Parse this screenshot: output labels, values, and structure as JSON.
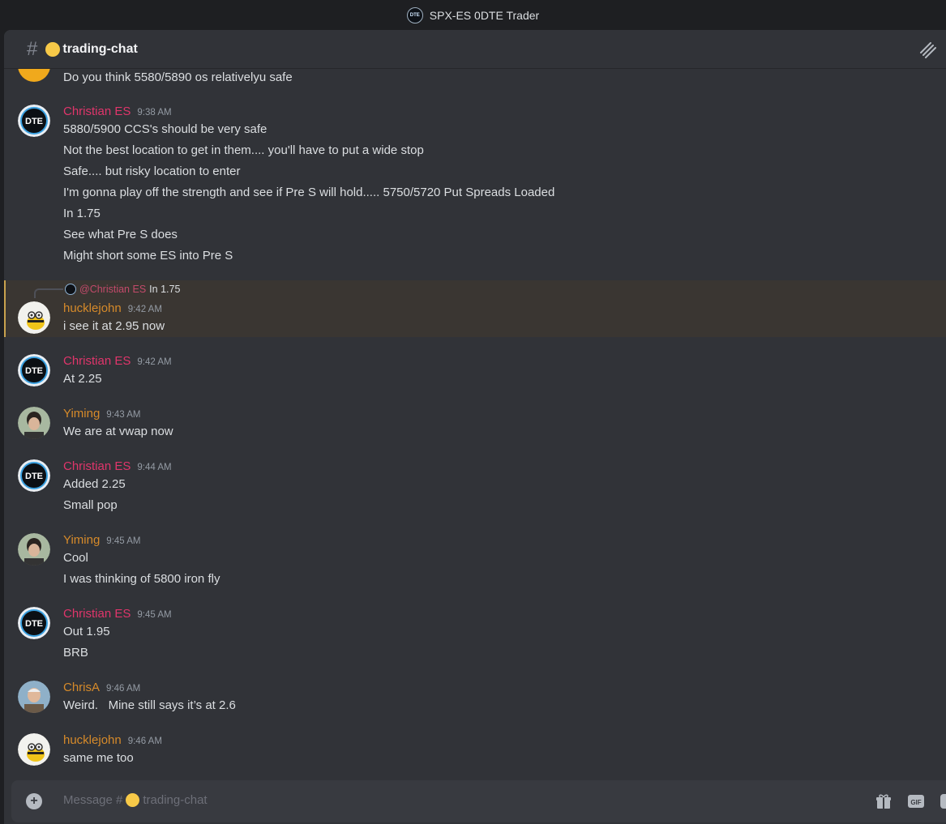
{
  "window": {
    "title": "SPX-ES 0DTE Trader",
    "logo_text": "DTE"
  },
  "channel": {
    "hash": "#",
    "name": "trading-chat"
  },
  "colors": {
    "christian": "#e0356b",
    "other": "#d68a2a"
  },
  "messages": [
    {
      "author": "",
      "time": "",
      "lines": [
        "Do you think 5580/5890 os relativelyu safe"
      ]
    },
    {
      "author": "Christian ES",
      "time": "9:38 AM",
      "lines": [
        "5880/5900 CCS's should be very safe",
        "Not the best location to get in them.... you'll have to put a wide stop",
        "Safe.... but risky location to enter",
        "I'm gonna play off the strength and see if Pre S will hold..... 5750/5720 Put Spreads Loaded",
        "In 1.75",
        "See what Pre S does",
        "Might short some ES into Pre S"
      ]
    },
    {
      "author": "hucklejohn",
      "time": "9:42 AM",
      "reply": {
        "mention": "@Christian ES",
        "text": "In 1.75"
      },
      "lines": [
        "i see it at 2.95 now"
      ]
    },
    {
      "author": "Christian ES",
      "time": "9:42 AM",
      "lines": [
        "At 2.25"
      ]
    },
    {
      "author": "Yiming",
      "time": "9:43 AM",
      "lines": [
        "We are at vwap now"
      ]
    },
    {
      "author": "Christian ES",
      "time": "9:44 AM",
      "lines": [
        "Added 2.25",
        "Small pop"
      ]
    },
    {
      "author": "Yiming",
      "time": "9:45 AM",
      "lines": [
        "Cool",
        "I was thinking of 5800 iron fly"
      ]
    },
    {
      "author": "Christian ES",
      "time": "9:45 AM",
      "lines": [
        "Out 1.95",
        "BRB"
      ]
    },
    {
      "author": "ChrisA",
      "time": "9:46 AM",
      "lines": [
        "Weird.   Mine still says it’s at 2.6"
      ]
    },
    {
      "author": "hucklejohn",
      "time": "9:46 AM",
      "lines": [
        "same me too"
      ]
    }
  ],
  "composer": {
    "placeholder_prefix": "Message #",
    "placeholder_channel": "trading-chat"
  },
  "icons": [
    "hash-icon",
    "threads-icon",
    "plus-circle-icon",
    "gift-icon",
    "gif-icon",
    "sticker-icon"
  ]
}
